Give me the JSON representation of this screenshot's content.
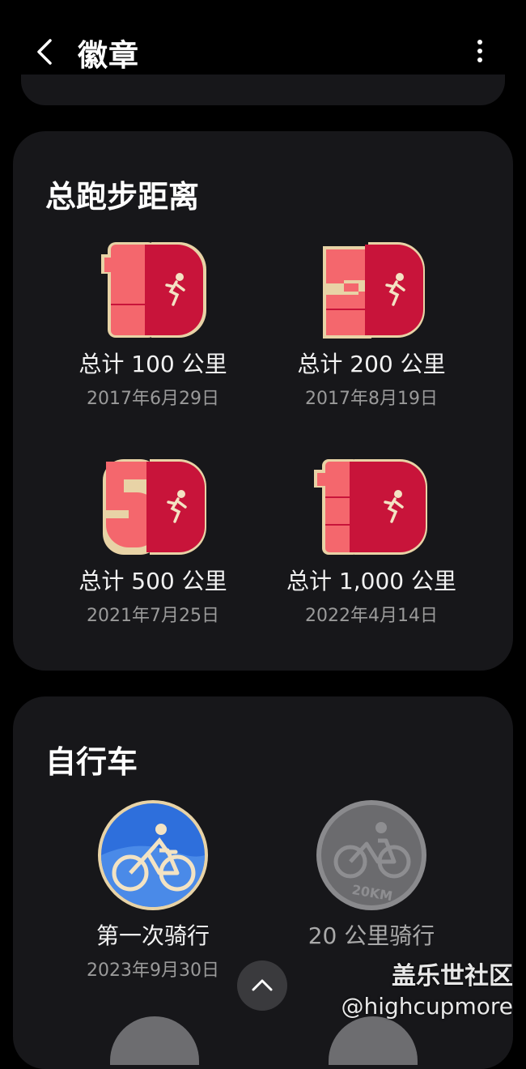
{
  "header": {
    "title": "徽章",
    "back_icon": "chevron-left-icon",
    "more_icon": "more-vertical-icon"
  },
  "running": {
    "title": "总跑步距离",
    "badges": [
      {
        "label": "总计 100 公里",
        "date": "2017年6月29日"
      },
      {
        "label": "总计 200 公里",
        "date": "2017年8月19日"
      },
      {
        "label": "总计 500 公里",
        "date": "2021年7月25日"
      },
      {
        "label": "总计 1,000 公里",
        "date": "2022年4月14日"
      }
    ]
  },
  "cycling": {
    "title": "自行车",
    "badges": [
      {
        "label": "第一次骑行",
        "date": "2023年9月30日"
      },
      {
        "label": "20 公里骑行",
        "badge_text": "20KM"
      }
    ]
  },
  "scroll_top_icon": "chevron-up-icon",
  "watermark": {
    "line1": "盖乐世社区",
    "line2": "@highcupmore"
  },
  "colors": {
    "badge_light": "#f4676d",
    "badge_dark": "#c8143a",
    "bike_blue": "#2e6fdc",
    "card_bg": "#17171a"
  }
}
